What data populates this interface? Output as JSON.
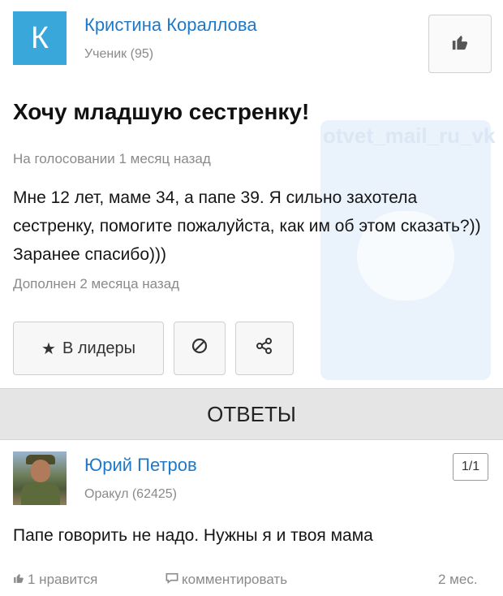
{
  "question": {
    "author": {
      "initial": "К",
      "name": "Кристина Кораллова",
      "rank": "Ученик (95)"
    },
    "title": "Хочу младшую сестренку!",
    "status": "На голосовании 1 месяц назад",
    "body": "Мне 12 лет, маме 34, а папе 39. Я сильно захотела сестренку, помогите пожалуйста, как им об этом сказать?)) Заранее спасибо)))",
    "added": "Дополнен 2 месяца назад",
    "leaders_label": "В лидеры"
  },
  "watermark": {
    "text": "otvet_mail_ru_vk"
  },
  "answers_header": "ОТВЕТЫ",
  "answer": {
    "name": "Юрий Петров",
    "rank": "Оракул (62425)",
    "counter": "1/1",
    "text": "Папе говорить не надо. Нужны я и твоя мама",
    "likes": "1 нравится",
    "comment": "комментировать",
    "age": "2 мес."
  },
  "icons": {
    "like": "thumbs-up-icon",
    "star": "star-icon",
    "report": "block-icon",
    "share": "share-icon",
    "comment": "comment-icon",
    "watermark": "speech-bubble-icon"
  }
}
